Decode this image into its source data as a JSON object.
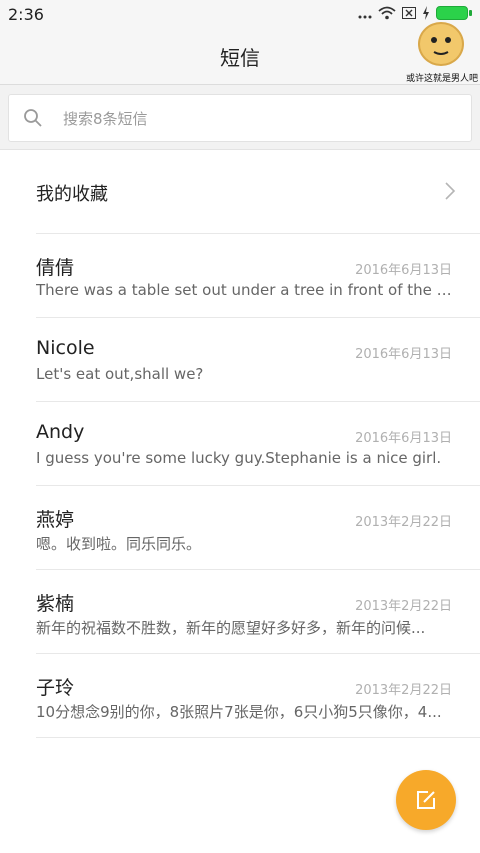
{
  "status_bar": {
    "time": "2:36"
  },
  "header": {
    "title": "短信",
    "sticker_caption": "或许这就是男人吧"
  },
  "search": {
    "placeholder": "搜索8条短信"
  },
  "favorites": {
    "label": "我的收藏"
  },
  "conversations": [
    {
      "name": "倩倩",
      "date": "2016年6月13日",
      "preview": "There was a table set out under a tree in front of the ho..."
    },
    {
      "name": "Nicole",
      "date": "2016年6月13日",
      "preview": "Let's eat out,shall we?"
    },
    {
      "name": "Andy",
      "date": "2016年6月13日",
      "preview": "I guess you're some lucky guy.Stephanie is a nice girl."
    },
    {
      "name": "燕婷",
      "date": "2013年2月22日",
      "preview": "嗯。收到啦。同乐同乐。"
    },
    {
      "name": "紫楠",
      "date": "2013年2月22日",
      "preview": "新年的祝福数不胜数，新年的愿望好多好多，新年的问候..."
    },
    {
      "name": "子玲",
      "date": "2013年2月22日",
      "preview": "10分想念9别的你，8张照片7张是你，6只小狗5只像你，4..."
    }
  ],
  "icons": {
    "signal": "signal-icon",
    "wifi": "wifi-icon",
    "no-sim": "no-sim-icon",
    "charging": "charging-icon",
    "battery": "battery-icon",
    "search": "search-icon",
    "chevron": "chevron-right-icon",
    "compose": "compose-icon"
  },
  "colors": {
    "accent": "#f7a92a",
    "battery": "#2bd24a"
  }
}
